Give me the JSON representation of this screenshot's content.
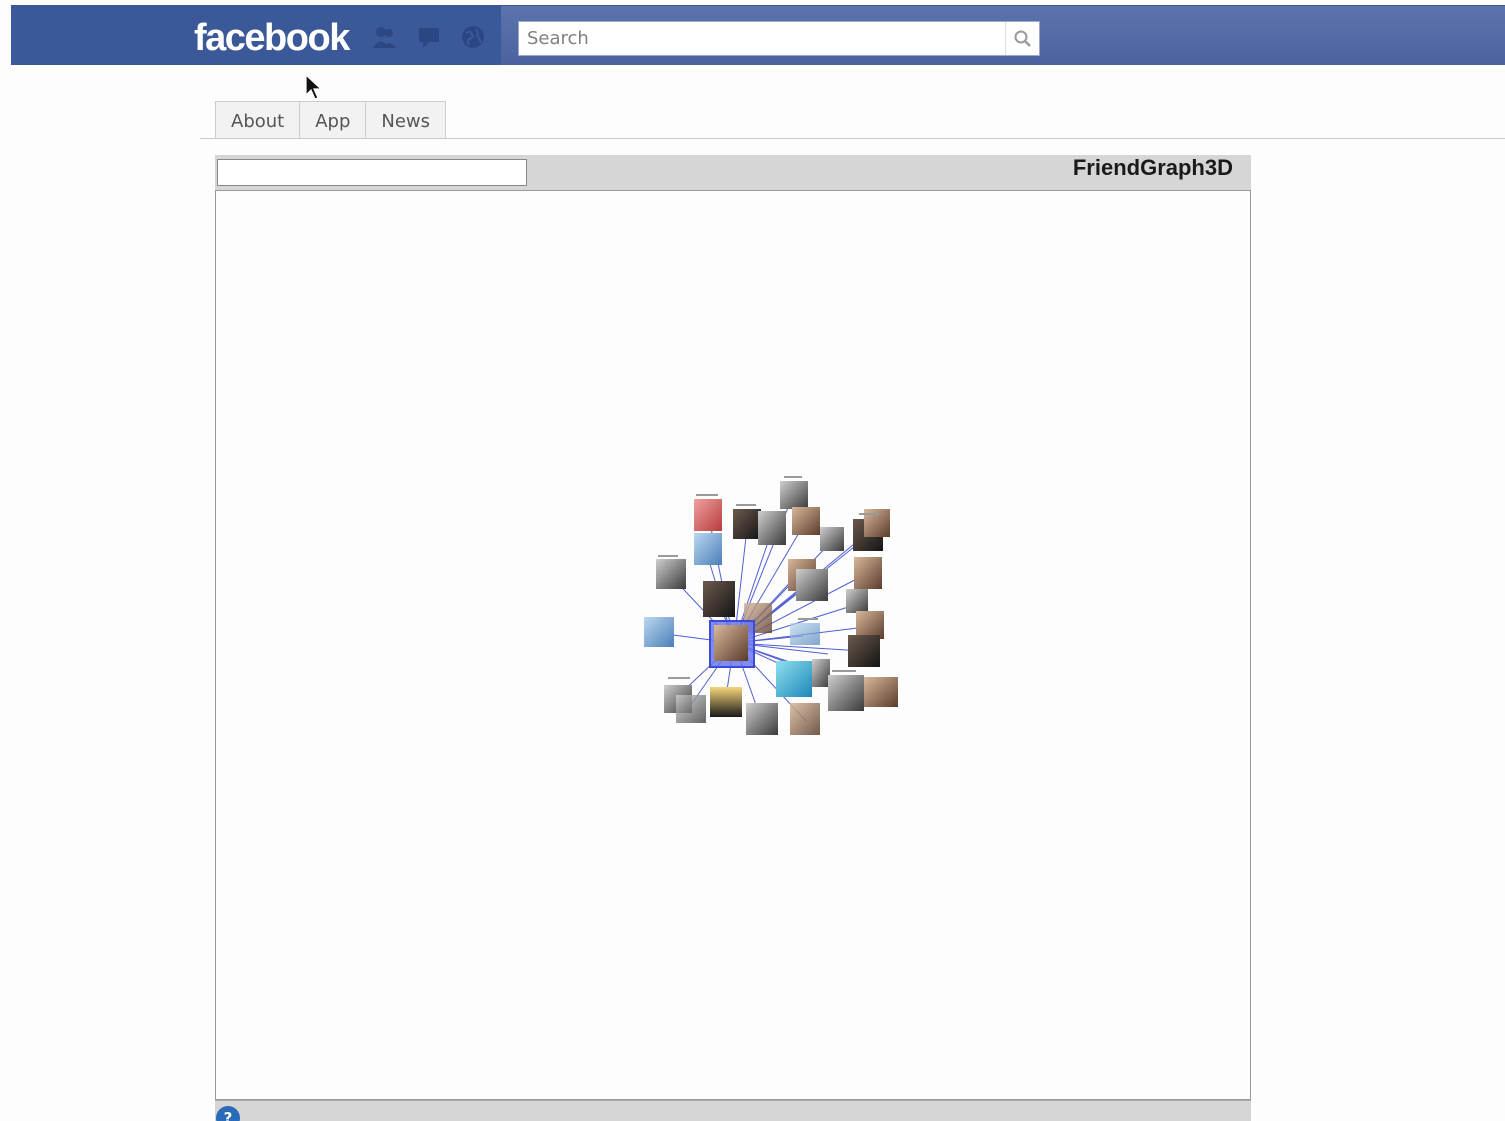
{
  "header": {
    "logo_text": "facebook",
    "search": {
      "placeholder": "Search",
      "value": ""
    },
    "icons": [
      "friend-requests-icon",
      "messages-icon",
      "notifications-icon",
      "search-icon"
    ],
    "colors": {
      "bar": "#3b5998",
      "bar_light": "#5b74ad"
    }
  },
  "tabs": [
    {
      "label": "About"
    },
    {
      "label": "App"
    },
    {
      "label": "News"
    }
  ],
  "app": {
    "title": "FriendGraph3D",
    "name_field_value": "",
    "help_label": "?",
    "graph": {
      "center_node": "profile-photo",
      "node_count": 31,
      "edge_color": "#3344cc"
    }
  }
}
